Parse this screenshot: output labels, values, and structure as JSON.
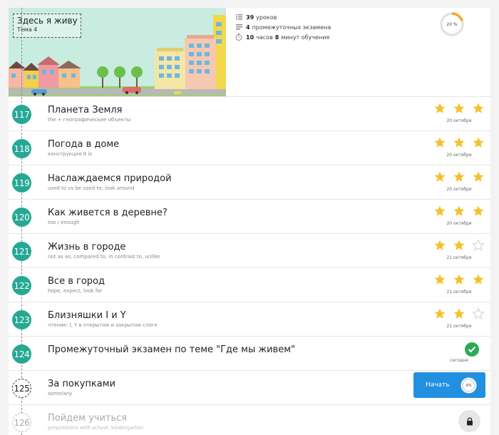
{
  "header": {
    "topic_title": "Здесь я живу",
    "topic_subtitle": "Тема 4",
    "stats": [
      {
        "icon": "list-icon",
        "count": "39",
        "label": "уроков"
      },
      {
        "icon": "menu-lines-icon",
        "count": "4",
        "label": "промежуточных экзамена"
      },
      {
        "icon": "timer-icon",
        "count": "10",
        "label_mid": "часов",
        "count2": "8",
        "label": "минут обучения"
      }
    ],
    "progress": {
      "label": "20 %",
      "value": 20
    }
  },
  "colors": {
    "teal": "#26a994",
    "star": "#f4c12d",
    "star_empty": "#cfcfcf",
    "blue": "#2290e0",
    "green": "#2eaa57",
    "ring_orange": "#f5a623"
  },
  "lessons": [
    {
      "num": "117",
      "title": "Планета Земля",
      "subtitle": "the + географические объекты",
      "stars": 3,
      "date": "20 октября",
      "state": "done"
    },
    {
      "num": "118",
      "title": "Погода в доме",
      "subtitle": "конструкция it is",
      "stars": 3,
      "date": "20 октября",
      "state": "done"
    },
    {
      "num": "119",
      "title": "Наслаждаемся природой",
      "subtitle": "used to vs be used to; look around",
      "stars": 3,
      "date": "20 октября",
      "state": "done"
    },
    {
      "num": "120",
      "title": "Как живется в деревне?",
      "subtitle": "too / enough",
      "stars": 3,
      "date": "20 октября",
      "state": "done"
    },
    {
      "num": "121",
      "title": "Жизнь в городе",
      "subtitle": "not as as; compared to, in contrast to, unlike",
      "stars": 2,
      "date": "21 октября",
      "state": "done"
    },
    {
      "num": "122",
      "title": "Все в город",
      "subtitle": "hope, expect, look for",
      "stars": 3,
      "date": "21 октября",
      "state": "done"
    },
    {
      "num": "123",
      "title": "Близняшки I и Y",
      "subtitle": "чтение: I, Y в открытом и закрытом слоге",
      "stars": 2,
      "date": "21 октября",
      "state": "done"
    },
    {
      "num": "124",
      "title": "Промежуточный экзамен по теме \"Где мы живем\"",
      "subtitle": "",
      "date": "сегодня",
      "state": "exam"
    },
    {
      "num": "125",
      "title": "За покупками",
      "subtitle": "some/any",
      "state": "current",
      "button": "Начать",
      "progress_label": "0%",
      "progress": 0
    },
    {
      "num": "126",
      "title": "Пойдем учиться",
      "subtitle": "prepositions with school, kindergarten",
      "state": "locked"
    }
  ]
}
